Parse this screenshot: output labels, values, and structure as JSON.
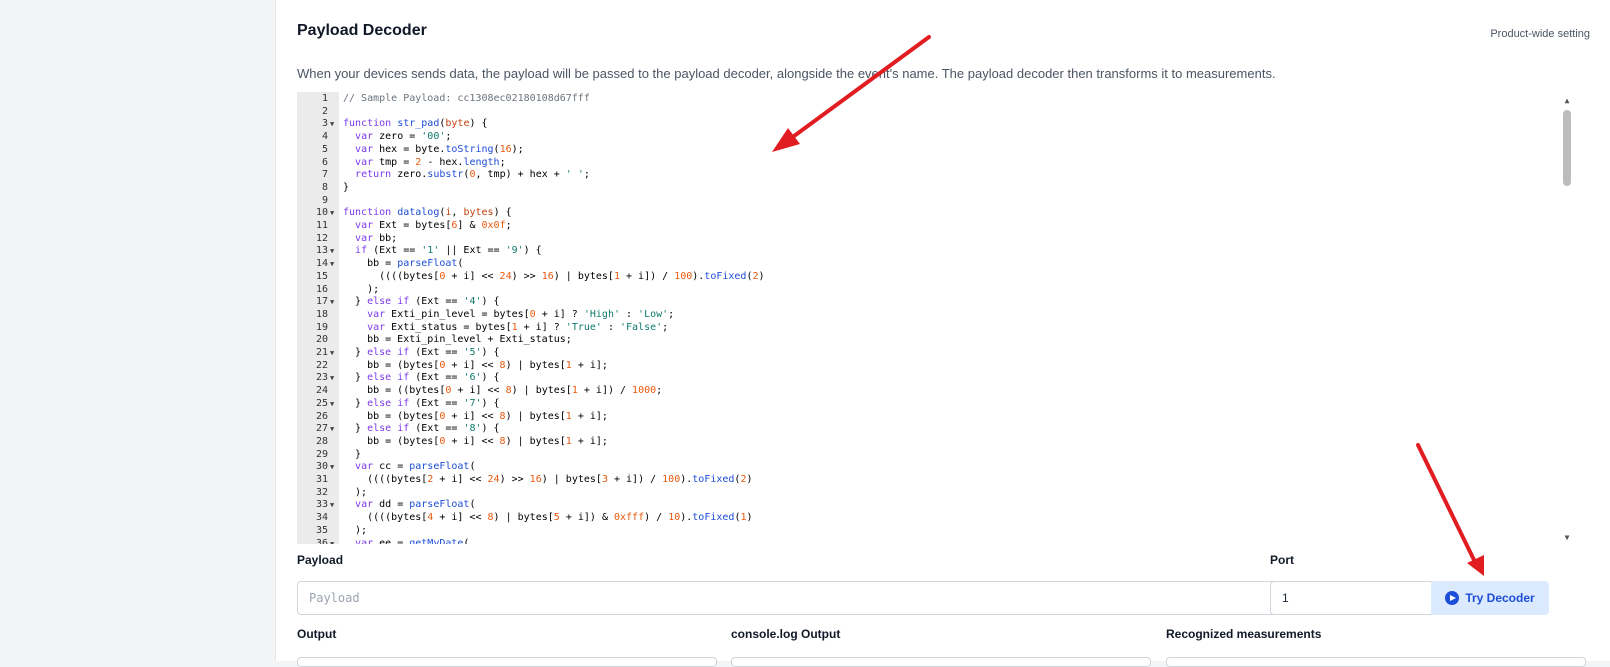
{
  "header": {
    "title": "Payload Decoder",
    "scope": "Product-wide setting",
    "description": "When your devices sends data, the payload will be passed to the payload decoder, alongside the event's name. The payload decoder then transforms it to measurements."
  },
  "editor": {
    "lines": [
      {
        "n": "1",
        "fold": false,
        "html": "<span class=\"c-com\">// Sample Payload: cc1308ec02180108d67fff</span>"
      },
      {
        "n": "2",
        "fold": false,
        "html": ""
      },
      {
        "n": "3",
        "fold": true,
        "html": "<span class=\"c-kw\">function</span> <span class=\"c-fn\">str_pad</span>(<span class=\"c-param\">byte</span>) {"
      },
      {
        "n": "4",
        "fold": false,
        "html": "  <span class=\"c-kw\">var</span> zero = <span class=\"c-str\">'00'</span>;"
      },
      {
        "n": "5",
        "fold": false,
        "html": "  <span class=\"c-kw\">var</span> hex = byte.<span class=\"c-fn\">toString</span>(<span class=\"c-num\">16</span>);"
      },
      {
        "n": "6",
        "fold": false,
        "html": "  <span class=\"c-kw\">var</span> tmp = <span class=\"c-num\">2</span> - hex.<span class=\"c-fn\">length</span>;"
      },
      {
        "n": "7",
        "fold": false,
        "html": "  <span class=\"c-kw\">return</span> zero.<span class=\"c-fn\">substr</span>(<span class=\"c-num\">0</span>, tmp) + hex + <span class=\"c-str\">' '</span>;"
      },
      {
        "n": "8",
        "fold": false,
        "html": "}"
      },
      {
        "n": "9",
        "fold": false,
        "html": ""
      },
      {
        "n": "10",
        "fold": true,
        "html": "<span class=\"c-kw\">function</span> <span class=\"c-fn\">datalog</span>(<span class=\"c-param\">i</span>, <span class=\"c-param\">bytes</span>) {"
      },
      {
        "n": "11",
        "fold": false,
        "html": "  <span class=\"c-kw\">var</span> Ext = bytes[<span class=\"c-num\">6</span>] &amp; <span class=\"c-num\">0x0f</span>;"
      },
      {
        "n": "12",
        "fold": false,
        "html": "  <span class=\"c-kw\">var</span> bb;"
      },
      {
        "n": "13",
        "fold": true,
        "html": "  <span class=\"c-kw\">if</span> (Ext == <span class=\"c-str\">'1'</span> || Ext == <span class=\"c-str\">'9'</span>) {"
      },
      {
        "n": "14",
        "fold": true,
        "html": "    bb = <span class=\"c-fn\">parseFloat</span>("
      },
      {
        "n": "15",
        "fold": false,
        "html": "      ((((bytes[<span class=\"c-num\">0</span> + i] &lt;&lt; <span class=\"c-num\">24</span>) &gt;&gt; <span class=\"c-num\">16</span>) | bytes[<span class=\"c-num\">1</span> + i]) / <span class=\"c-num\">100</span>).<span class=\"c-fn\">toFixed</span>(<span class=\"c-num\">2</span>)"
      },
      {
        "n": "16",
        "fold": false,
        "html": "    );"
      },
      {
        "n": "17",
        "fold": true,
        "html": "  } <span class=\"c-kw\">else if</span> (Ext == <span class=\"c-str\">'4'</span>) {"
      },
      {
        "n": "18",
        "fold": false,
        "html": "    <span class=\"c-kw\">var</span> Exti_pin_level = bytes[<span class=\"c-num\">0</span> + i] ? <span class=\"c-str\">'High'</span> : <span class=\"c-str\">'Low'</span>;"
      },
      {
        "n": "19",
        "fold": false,
        "html": "    <span class=\"c-kw\">var</span> Exti_status = bytes[<span class=\"c-num\">1</span> + i] ? <span class=\"c-str\">'True'</span> : <span class=\"c-str\">'False'</span>;"
      },
      {
        "n": "20",
        "fold": false,
        "html": "    bb = Exti_pin_level + Exti_status;"
      },
      {
        "n": "21",
        "fold": true,
        "html": "  } <span class=\"c-kw\">else if</span> (Ext == <span class=\"c-str\">'5'</span>) {"
      },
      {
        "n": "22",
        "fold": false,
        "html": "    bb = (bytes[<span class=\"c-num\">0</span> + i] &lt;&lt; <span class=\"c-num\">8</span>) | bytes[<span class=\"c-num\">1</span> + i];"
      },
      {
        "n": "23",
        "fold": true,
        "html": "  } <span class=\"c-kw\">else if</span> (Ext == <span class=\"c-str\">'6'</span>) {"
      },
      {
        "n": "24",
        "fold": false,
        "html": "    bb = ((bytes[<span class=\"c-num\">0</span> + i] &lt;&lt; <span class=\"c-num\">8</span>) | bytes[<span class=\"c-num\">1</span> + i]) / <span class=\"c-num\">1000</span>;"
      },
      {
        "n": "25",
        "fold": true,
        "html": "  } <span class=\"c-kw\">else if</span> (Ext == <span class=\"c-str\">'7'</span>) {"
      },
      {
        "n": "26",
        "fold": false,
        "html": "    bb = (bytes[<span class=\"c-num\">0</span> + i] &lt;&lt; <span class=\"c-num\">8</span>) | bytes[<span class=\"c-num\">1</span> + i];"
      },
      {
        "n": "27",
        "fold": true,
        "html": "  } <span class=\"c-kw\">else if</span> (Ext == <span class=\"c-str\">'8'</span>) {"
      },
      {
        "n": "28",
        "fold": false,
        "html": "    bb = (bytes[<span class=\"c-num\">0</span> + i] &lt;&lt; <span class=\"c-num\">8</span>) | bytes[<span class=\"c-num\">1</span> + i];"
      },
      {
        "n": "29",
        "fold": false,
        "html": "  }"
      },
      {
        "n": "30",
        "fold": true,
        "html": "  <span class=\"c-kw\">var</span> cc = <span class=\"c-fn\">parseFloat</span>("
      },
      {
        "n": "31",
        "fold": false,
        "html": "    ((((bytes[<span class=\"c-num\">2</span> + i] &lt;&lt; <span class=\"c-num\">24</span>) &gt;&gt; <span class=\"c-num\">16</span>) | bytes[<span class=\"c-num\">3</span> + i]) / <span class=\"c-num\">100</span>).<span class=\"c-fn\">toFixed</span>(<span class=\"c-num\">2</span>)"
      },
      {
        "n": "32",
        "fold": false,
        "html": "  );"
      },
      {
        "n": "33",
        "fold": true,
        "html": "  <span class=\"c-kw\">var</span> dd = <span class=\"c-fn\">parseFloat</span>("
      },
      {
        "n": "34",
        "fold": false,
        "html": "    ((((bytes[<span class=\"c-num\">4</span> + i] &lt;&lt; <span class=\"c-num\">8</span>) | bytes[<span class=\"c-num\">5</span> + i]) &amp; <span class=\"c-num\">0xfff</span>) / <span class=\"c-num\">10</span>).<span class=\"c-fn\">toFixed</span>(<span class=\"c-num\">1</span>)"
      },
      {
        "n": "35",
        "fold": false,
        "html": "  );"
      },
      {
        "n": "36",
        "fold": true,
        "html": "  <span class=\"c-kw\">var</span> ee = <span class=\"c-fn\">getMyDate</span>("
      }
    ]
  },
  "payload": {
    "label": "Payload",
    "placeholder": "Payload",
    "value": ""
  },
  "port": {
    "label": "Port",
    "value": "1"
  },
  "try_button": {
    "label": "Try Decoder",
    "icon": "play-circle-icon"
  },
  "outputs": {
    "output_label": "Output",
    "console_label": "console.log Output",
    "measurements_label": "Recognized measurements"
  },
  "colors": {
    "accent": "#1d4ed8",
    "button_bg": "#dbeafe",
    "arrow": "#e11d22"
  }
}
